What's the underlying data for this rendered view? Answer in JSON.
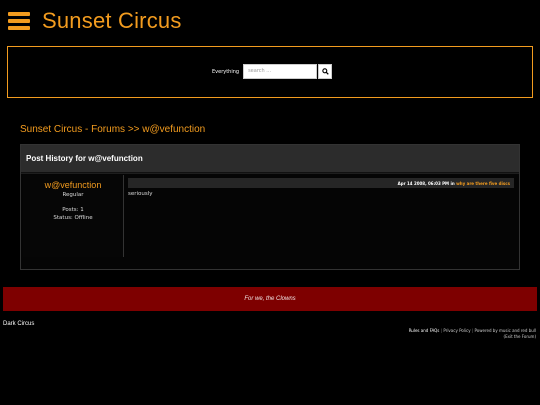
{
  "header": {
    "site_title": "Sunset Circus",
    "menu_icon": "hamburger-menu-icon"
  },
  "search": {
    "scope_label": "Everything",
    "placeholder": "search ...",
    "button_icon": "search-icon"
  },
  "breadcrumb": {
    "forums_link": "Sunset Circus - Forums",
    "separator": ">>",
    "current": "w@vefunction"
  },
  "panel": {
    "title": "Post History for w@vefunction",
    "user": {
      "name": "w@vefunction",
      "rank": "Regular",
      "posts": "Posts: 1",
      "status": "Status: Offline"
    },
    "post": {
      "date": "Apr 14 2008, 06:03 PM",
      "in_word": "in",
      "thread": "why are there five discs",
      "content": "seriously"
    }
  },
  "banner": {
    "text": "For we, the Clowns"
  },
  "footer": {
    "theme_name": "Dark Circus",
    "rules_link": "Rules and FAQs",
    "privacy_link": "Privacy Policy",
    "powered_by": "Powered by music and red bull",
    "exit_link": "(Exit the Forum)",
    "separator": "|"
  },
  "colors": {
    "accent": "#f39c1f",
    "banner": "#7e0000",
    "background": "#000000"
  }
}
